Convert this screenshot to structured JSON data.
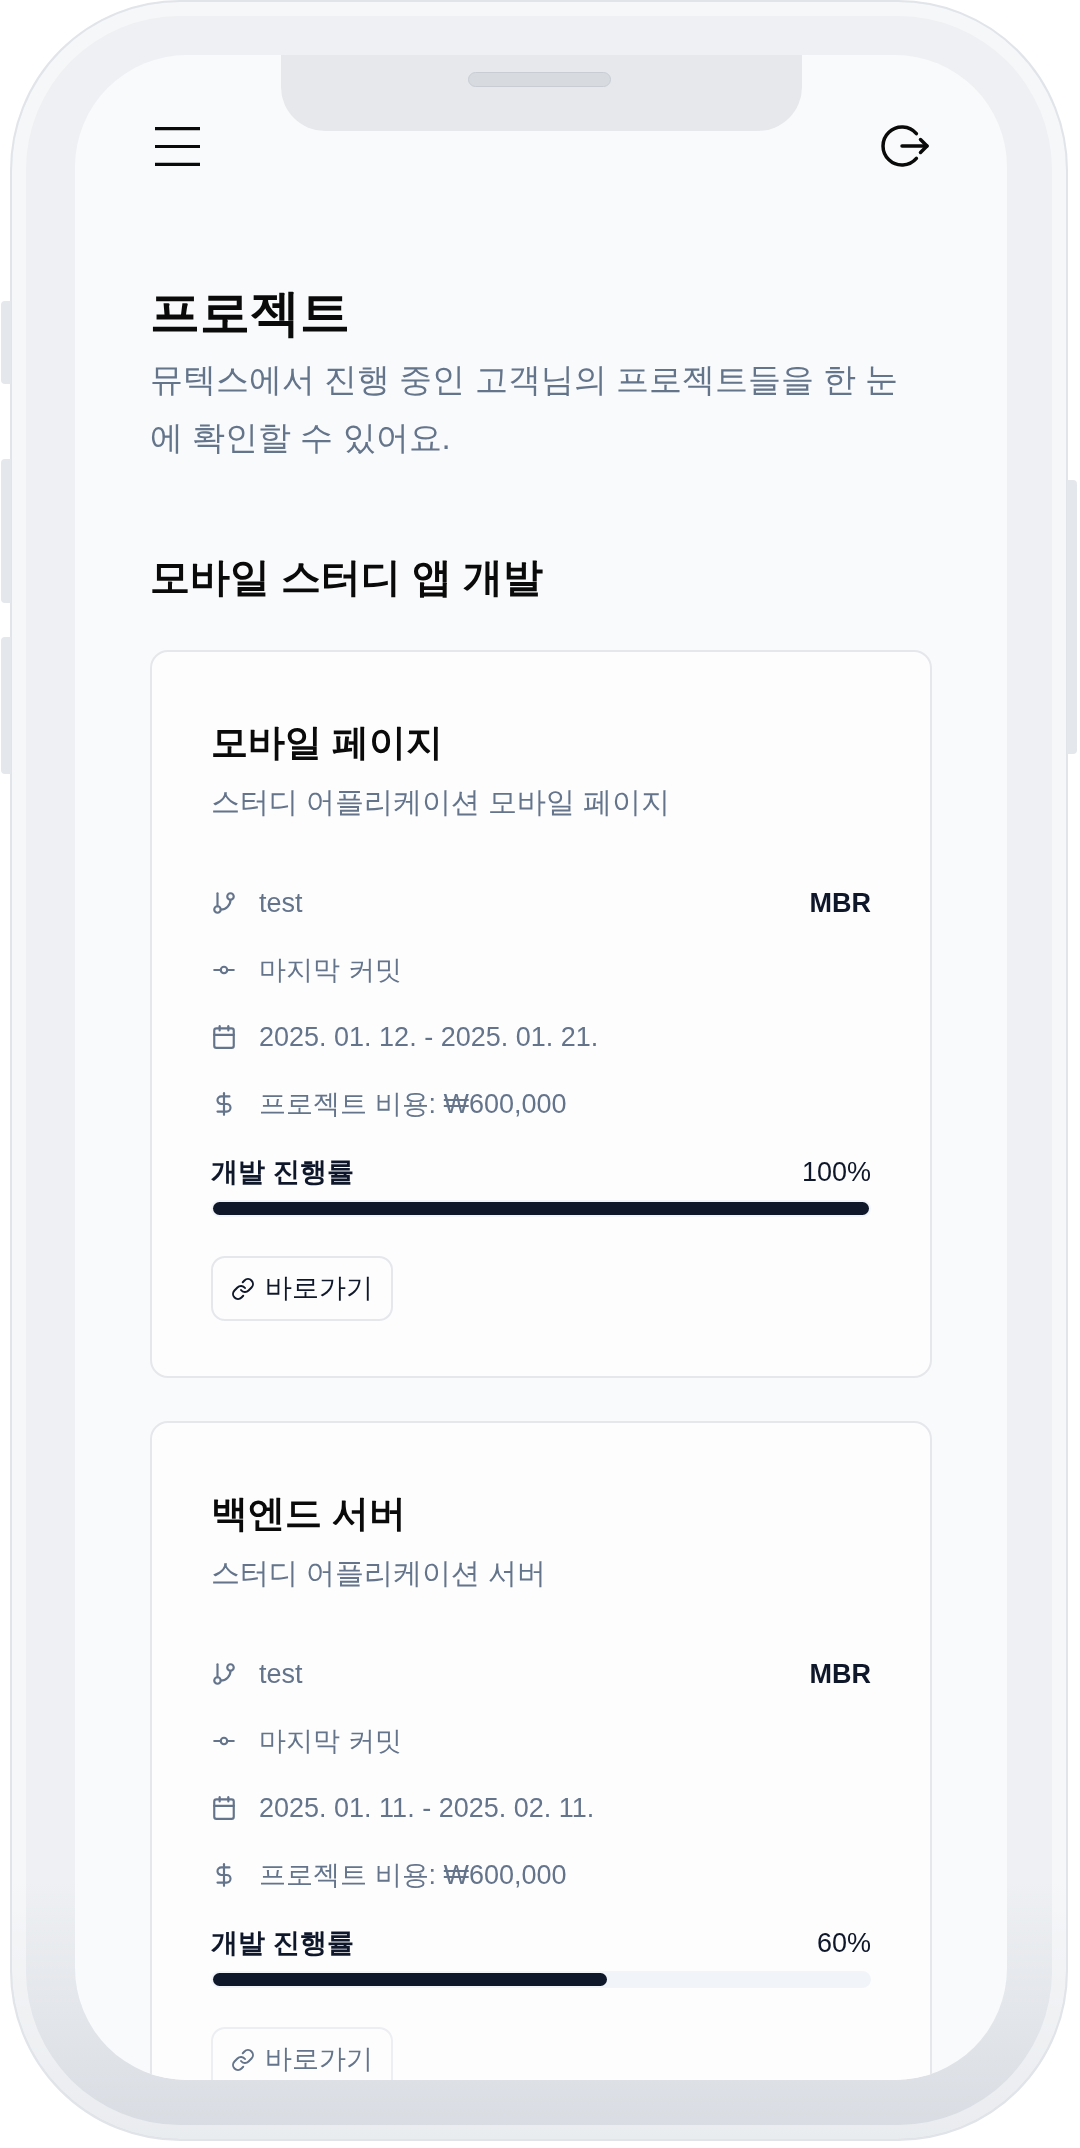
{
  "page": {
    "title": "프로젝트",
    "description": "뮤텍스에서 진행 중인 고객님의 프로젝트들을 한 눈에 확인할 수 있어요."
  },
  "section": {
    "title": "모바일 스터디 앱 개발",
    "projects": [
      {
        "name": "모바일 페이지",
        "description": "스터디 어플리케이션 모바일 페이지",
        "details": [
          {
            "kind": "branch",
            "text": "test",
            "side_text": "MBR"
          },
          {
            "kind": "commit",
            "text": "마지막 커밋"
          },
          {
            "kind": "period",
            "text": "2025. 01. 12. - 2025. 01. 21."
          },
          {
            "kind": "cost",
            "text": "프로젝트 비용: ₩600,000"
          }
        ],
        "progress": {
          "label": "개발 진행률",
          "reading": "100%",
          "level": 1
        },
        "link": {
          "label": "바로가기",
          "disabled": false
        }
      },
      {
        "name": "백엔드 서버",
        "description": "스터디 어플리케이션 서버",
        "details": [
          {
            "kind": "branch",
            "text": "test",
            "side_text": "MBR"
          },
          {
            "kind": "commit",
            "text": "마지막 커밋"
          },
          {
            "kind": "period",
            "text": "2025. 01. 11. - 2025. 02. 11."
          },
          {
            "kind": "cost",
            "text": "프로젝트 비용: ₩600,000"
          }
        ],
        "progress": {
          "label": "개발 진행률",
          "reading": "60%",
          "level": 0.6
        },
        "link": {
          "label": "바로가기",
          "disabled": true
        }
      }
    ]
  }
}
